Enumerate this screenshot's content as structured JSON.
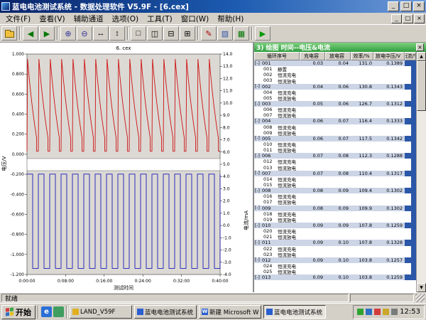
{
  "window": {
    "title": "蓝电电池测试系统 - 数据处理软件 V5.9F - [6.cex]",
    "controls": {
      "minimize": "_",
      "restore": "□",
      "close": "×"
    },
    "menus": [
      {
        "name": "menu-file",
        "label": "文件(F)"
      },
      {
        "name": "menu-view",
        "label": "查看(V)"
      },
      {
        "name": "menu-aux-channel",
        "label": "辅助通道"
      },
      {
        "name": "menu-options",
        "label": "选项(O)"
      },
      {
        "name": "menu-tools",
        "label": "工具(T)"
      },
      {
        "name": "menu-window",
        "label": "窗口(W)"
      },
      {
        "name": "menu-help",
        "label": "帮助(H)"
      }
    ],
    "statusbar": "就绪"
  },
  "toolbar": {
    "buttons": [
      {
        "name": "open-file-button",
        "icon": "folder"
      },
      {
        "sep": true
      },
      {
        "name": "back-button",
        "glyph": "◀",
        "color": "#007700"
      },
      {
        "name": "forward-button",
        "glyph": "▶",
        "color": "#007700"
      },
      {
        "sep": true
      },
      {
        "name": "zoom-in-button",
        "glyph": "⊕",
        "color": "#333399"
      },
      {
        "name": "zoom-out-button",
        "glyph": "⊖",
        "color": "#333399"
      },
      {
        "name": "zoom-horizontal-button",
        "glyph": "↔",
        "color": "#000000"
      },
      {
        "name": "zoom-vertical-button",
        "glyph": "↕",
        "color": "#000000"
      },
      {
        "sep": true
      },
      {
        "name": "layout-single-button",
        "glyph": "□",
        "color": "#000000"
      },
      {
        "name": "layout-two-horizontal-button",
        "glyph": "◫",
        "color": "#000000"
      },
      {
        "name": "layout-two-vertical-button",
        "glyph": "⊟",
        "color": "#000000"
      },
      {
        "name": "layout-four-button",
        "glyph": "⊞",
        "color": "#000000"
      },
      {
        "sep": true
      },
      {
        "name": "curve-color-button",
        "glyph": "✎",
        "color": "#aa0000"
      },
      {
        "name": "background-color-button",
        "glyph": "▨",
        "color": "#3355aa"
      },
      {
        "name": "chart-settings-button",
        "glyph": "▦",
        "color": "#007700"
      },
      {
        "sep": true
      },
      {
        "name": "run-button",
        "glyph": "▶",
        "color": "#009900"
      }
    ]
  },
  "chart_data": {
    "type": "line",
    "title": "6. cex",
    "xlabel": "测试时间",
    "x_ticks": [
      "0:00:00",
      "0:08:00",
      "0:16:00",
      "0:24:00",
      "0:32:00",
      "0:40:00"
    ],
    "left_axis": {
      "label": "电压/V",
      "max": 1.0,
      "min": -1.2,
      "ticks": [
        "1.000",
        "0.800",
        "0.600",
        "0.400",
        "0.200",
        "0.000",
        "-0.200",
        "-0.400",
        "-0.600",
        "-0.800",
        "-1.000",
        "-1.200"
      ]
    },
    "right_axis": {
      "label": "电流/mA",
      "max": 14.0,
      "min": -4.0,
      "ticks": [
        "14.0",
        "13.0",
        "12.0",
        "11.0",
        "10.0",
        "9.0",
        "8.0",
        "7.0",
        "6.0",
        "5.0",
        "4.0",
        "3.0",
        "2.0",
        "1.0",
        "0.0",
        "-1.0",
        "-2.0",
        "-3.0",
        "-4.0"
      ]
    },
    "series": [
      {
        "name": "电压",
        "axis": "left",
        "color": "#cc1111",
        "type": "sawtooth",
        "cycles": 17,
        "peak_v": 0.95,
        "base_v": 0.03,
        "decay_end_v": 0.16
      },
      {
        "name": "电流",
        "axis": "right",
        "color": "#1a1ab8",
        "type": "square",
        "cycles": 17,
        "high_ma": 4.2,
        "low_ma": -3.5
      }
    ],
    "grid": false,
    "legend": false
  },
  "panel": {
    "tab_label": "3) 绘图  时间--电压&电流",
    "close_glyph": "×",
    "collapse_glyph": "[-]",
    "headers": [
      "循环序号",
      "充电容",
      "放电容",
      "效率/%",
      "放电中压/V",
      "恒流/%"
    ],
    "groups": [
      {
        "id": "001",
        "charge": "0.03",
        "discharge": "0.04",
        "eff": "131.0",
        "mid_v": "0.1389",
        "records": [
          {
            "id": "001",
            "label": "静置"
          },
          {
            "id": "002",
            "label": "恒流充电"
          },
          {
            "id": "003",
            "label": "恒流放电"
          }
        ]
      },
      {
        "id": "002",
        "charge": "0.04",
        "discharge": "0.06",
        "eff": "130.8",
        "mid_v": "0.1343",
        "records": [
          {
            "id": "004",
            "label": "恒流充电"
          },
          {
            "id": "005",
            "label": "恒流放电"
          }
        ]
      },
      {
        "id": "003",
        "charge": "0.05",
        "discharge": "0.06",
        "eff": "126.7",
        "mid_v": "0.1312",
        "records": [
          {
            "id": "006",
            "label": "恒流充电"
          },
          {
            "id": "007",
            "label": "恒流放电"
          }
        ]
      },
      {
        "id": "004",
        "charge": "0.06",
        "discharge": "0.07",
        "eff": "116.4",
        "mid_v": "0.1333",
        "records": [
          {
            "id": "008",
            "label": "恒流充电"
          },
          {
            "id": "009",
            "label": "恒流放电"
          }
        ]
      },
      {
        "id": "005",
        "charge": "0.06",
        "discharge": "0.07",
        "eff": "117.5",
        "mid_v": "0.1342",
        "records": [
          {
            "id": "010",
            "label": "恒流充电"
          },
          {
            "id": "011",
            "label": "恒流放电"
          }
        ]
      },
      {
        "id": "006",
        "charge": "0.07",
        "discharge": "0.08",
        "eff": "112.3",
        "mid_v": "0.1288",
        "records": [
          {
            "id": "012",
            "label": "恒流充电"
          },
          {
            "id": "013",
            "label": "恒流放电"
          }
        ]
      },
      {
        "id": "007",
        "charge": "0.07",
        "discharge": "0.08",
        "eff": "110.4",
        "mid_v": "0.1317",
        "records": [
          {
            "id": "014",
            "label": "恒流充电"
          },
          {
            "id": "015",
            "label": "恒流放电"
          }
        ]
      },
      {
        "id": "008",
        "charge": "0.08",
        "discharge": "0.09",
        "eff": "109.4",
        "mid_v": "0.1302",
        "records": [
          {
            "id": "016",
            "label": "恒流充电"
          },
          {
            "id": "017",
            "label": "恒流放电"
          }
        ]
      },
      {
        "id": "009",
        "charge": "0.08",
        "discharge": "0.09",
        "eff": "109.9",
        "mid_v": "0.1302",
        "records": [
          {
            "id": "018",
            "label": "恒流充电"
          },
          {
            "id": "019",
            "label": "恒流放电"
          }
        ]
      },
      {
        "id": "010",
        "charge": "0.09",
        "discharge": "0.09",
        "eff": "107.8",
        "mid_v": "0.1259",
        "records": [
          {
            "id": "020",
            "label": "恒流充电"
          },
          {
            "id": "021",
            "label": "恒流放电"
          }
        ]
      },
      {
        "id": "011",
        "charge": "0.09",
        "discharge": "0.10",
        "eff": "107.8",
        "mid_v": "0.1328",
        "records": [
          {
            "id": "022",
            "label": "恒流充电"
          },
          {
            "id": "023",
            "label": "恒流放电"
          }
        ]
      },
      {
        "id": "012",
        "charge": "0.09",
        "discharge": "0.10",
        "eff": "103.8",
        "mid_v": "0.1257",
        "records": [
          {
            "id": "024",
            "label": "恒流充电"
          },
          {
            "id": "025",
            "label": "恒流放电"
          }
        ]
      },
      {
        "id": "013",
        "charge": "0.09",
        "discharge": "0.10",
        "eff": "103.8",
        "mid_v": "0.1259",
        "records": []
      }
    ]
  },
  "taskbar": {
    "start_label": "开始",
    "quicklaunch": [
      {
        "name": "quicklaunch-browser-icon",
        "glyph": "e",
        "color": "#2a6fd6"
      },
      {
        "name": "quicklaunch-show-desktop-icon",
        "glyph": "",
        "color": "#3f9e5f"
      }
    ],
    "tasks": [
      {
        "name": "task-land-v59f",
        "label": "LAND_V59F",
        "icon_color": "#e0b020",
        "icon_glyph": "",
        "active": false
      },
      {
        "name": "task-land-test-system-1",
        "label": "蓝电电池测试系统...",
        "icon_color": "#2a5fd0",
        "icon_glyph": "",
        "active": false
      },
      {
        "name": "task-word-doc",
        "label": "新建 Microsoft W...",
        "icon_color": "#2a5fd0",
        "icon_glyph": "W",
        "active": false
      },
      {
        "name": "task-land-test-system-2",
        "label": "蓝电电池测试系统...",
        "icon_color": "#2a5fd0",
        "icon_glyph": "",
        "active": true
      }
    ],
    "tray_icons": [
      {
        "name": "tray-icon-1",
        "color": "#2fa32f"
      },
      {
        "name": "tray-icon-2",
        "color": "#2f6fc4"
      },
      {
        "name": "tray-icon-3",
        "color": "#d43b3b"
      },
      {
        "name": "tray-icon-4",
        "color": "#caa62a"
      },
      {
        "name": "tray-icon-5",
        "color": "#7a7a7a"
      }
    ],
    "clock": "12:53"
  }
}
